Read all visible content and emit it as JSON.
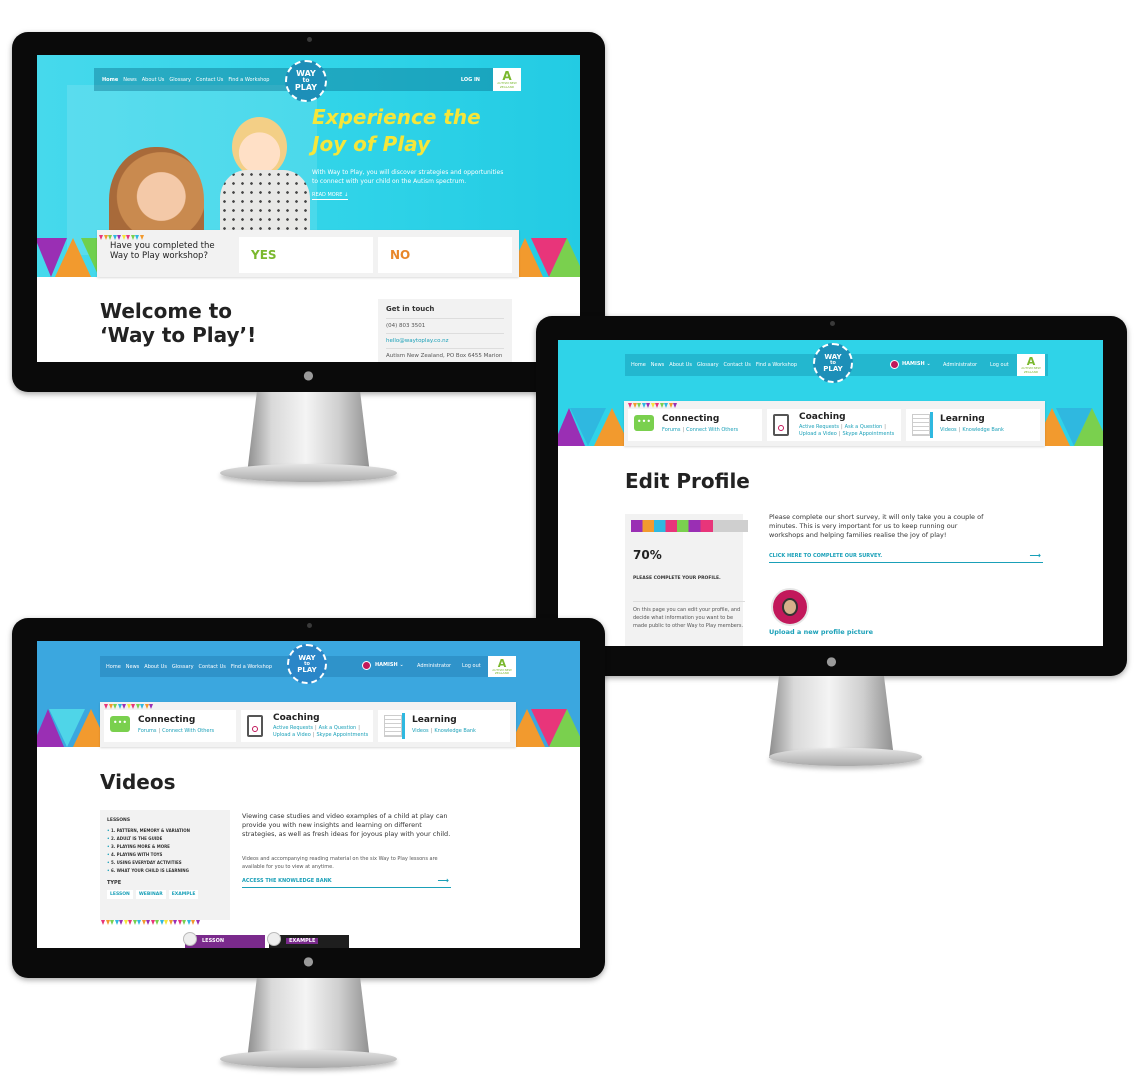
{
  "m1": {
    "nav": [
      "Home",
      "News",
      "About Us",
      "Glossary",
      "Contact Us",
      "Find a Workshop"
    ],
    "login": "LOG IN",
    "logo": {
      "top": "WAY",
      "mid": "to",
      "bot": "PLAY"
    },
    "autism_logo": {
      "letter": "A",
      "text": "AUTISM NEW ZEALAND"
    },
    "headline1": "Experience the",
    "headline2": "Joy of Play",
    "intro": "With Way to Play, you will discover strategies and opportunities to connect with your child on the Autism spectrum.",
    "read_more": "READ MORE",
    "question": "Have you completed the Way to Play workshop?",
    "yes": "YES",
    "no": "NO",
    "welcome1": "Welcome to",
    "welcome2": "‘Way to Play’!",
    "touch_title": "Get in touch",
    "phone": "(04) 803 3501",
    "email": "hello@waytoplay.co.nz",
    "address": "Autism New Zealand, PO Box 6455 Marion"
  },
  "m2": {
    "nav": [
      "Home",
      "News",
      "About Us",
      "Glossary",
      "Contact Us",
      "Find a Workshop"
    ],
    "user": "HAMISH",
    "admin": "Administrator",
    "logout": "Log out",
    "connecting": {
      "title": "Connecting",
      "l1": "Forums",
      "l2": "Connect With Others"
    },
    "coaching": {
      "title": "Coaching",
      "l1": "Active Requests",
      "l2": "Ask a Question",
      "l3": "Upload a Video",
      "l4": "Skype Appointments"
    },
    "learning": {
      "title": "Learning",
      "l1": "Videos",
      "l2": "Knowledge Bank"
    },
    "page_title": "Edit Profile",
    "percent": "70%",
    "progress": 0.7,
    "complete_label": "PLEASE COMPLETE YOUR PROFILE.",
    "side_text": "On this page you can edit your profile, and decide what information you want to be made public to other Way to Play members.",
    "survey_text": "Please complete our short survey, it will only take you a couple of minutes. This is very important for us to keep running our workshops and helping families realise the joy of play!",
    "survey_link": "CLICK HERE TO COMPLETE OUR SURVEY.",
    "upload": "Upload a new profile picture"
  },
  "m3": {
    "nav": [
      "Home",
      "News",
      "About Us",
      "Glossary",
      "Contact Us",
      "Find a Workshop"
    ],
    "user": "HAMISH",
    "admin": "Administrator",
    "logout": "Log out",
    "connecting": {
      "title": "Connecting",
      "l1": "Forums",
      "l2": "Connect With Others"
    },
    "coaching": {
      "title": "Coaching",
      "l1": "Active Requests",
      "l2": "Ask a Question",
      "l3": "Upload a Video",
      "l4": "Skype Appointments"
    },
    "learning": {
      "title": "Learning",
      "l1": "Videos",
      "l2": "Knowledge Bank"
    },
    "page_title": "Videos",
    "lessons_title": "LESSONS",
    "lessons": [
      "1. PATTERN, MEMORY & VARIATION",
      "2. ADULT IS THE GUIDE",
      "3. PLAYING MORE & MORE",
      "4. PLAYING WITH TOYS",
      "5. USING EVERYDAY ACTIVITIES",
      "6. WHAT YOUR CHILD IS LEARNING"
    ],
    "type_title": "TYPE",
    "types": [
      "LESSON",
      "WEBINAR",
      "EXAMPLE"
    ],
    "body1": "Viewing case studies and video examples of a child at play can provide you with new insights and learning on different strategies, as well as fresh ideas for joyous play with your child.",
    "body2": "Videos and accompanying reading material on the six Way to Play lessons are available for you to view at anytime.",
    "access": "ACCESS THE KNOWLEDGE BANK",
    "tile1": "LESSON",
    "tile2": "EXAMPLE"
  },
  "colors": {
    "cyan": "#2fd3e8",
    "teal": "#1aa0b8",
    "blue": "#3ba7df",
    "green": "#7ab82e",
    "orange": "#e8872a",
    "yellow": "#f5e63a"
  }
}
